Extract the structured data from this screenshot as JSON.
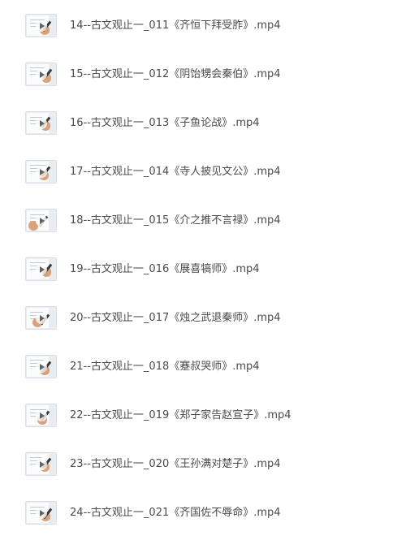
{
  "files": [
    {
      "name": "14--古文观止一_011《齐恒下拜受胙》.mp4",
      "thumbnail_icon": "video-thumbnail-icon"
    },
    {
      "name": "15--古文观止一_012《阴饴甥会秦伯》.mp4",
      "thumbnail_icon": "video-thumbnail-icon"
    },
    {
      "name": "16--古文观止一_013《子鱼论战》.mp4",
      "thumbnail_icon": "video-thumbnail-icon"
    },
    {
      "name": "17--古文观止一_014《寺人披见文公》.mp4",
      "thumbnail_icon": "video-thumbnail-icon"
    },
    {
      "name": "18--古文观止一_015《介之推不言禄》.mp4",
      "thumbnail_icon": "video-thumbnail-icon"
    },
    {
      "name": "19--古文观止一_016《展喜犒师》.mp4",
      "thumbnail_icon": "video-thumbnail-icon"
    },
    {
      "name": "20--古文观止一_017《烛之武退秦师》.mp4",
      "thumbnail_icon": "video-thumbnail-icon"
    },
    {
      "name": "21--古文观止一_018《蹇叔哭师》.mp4",
      "thumbnail_icon": "video-thumbnail-icon"
    },
    {
      "name": "22--古文观止一_019《郑子家告赵宣子》.mp4",
      "thumbnail_icon": "video-thumbnail-icon"
    },
    {
      "name": "23--古文观止一_020《王孙满对楚子》.mp4",
      "thumbnail_icon": "video-thumbnail-icon"
    },
    {
      "name": "24--古文观止一_021《齐国佐不辱命》.mp4",
      "thumbnail_icon": "video-thumbnail-icon"
    }
  ],
  "colors": {
    "text": "#4a4a4a",
    "background": "#ffffff",
    "thumbnail_bg": "#e9edf3"
  }
}
